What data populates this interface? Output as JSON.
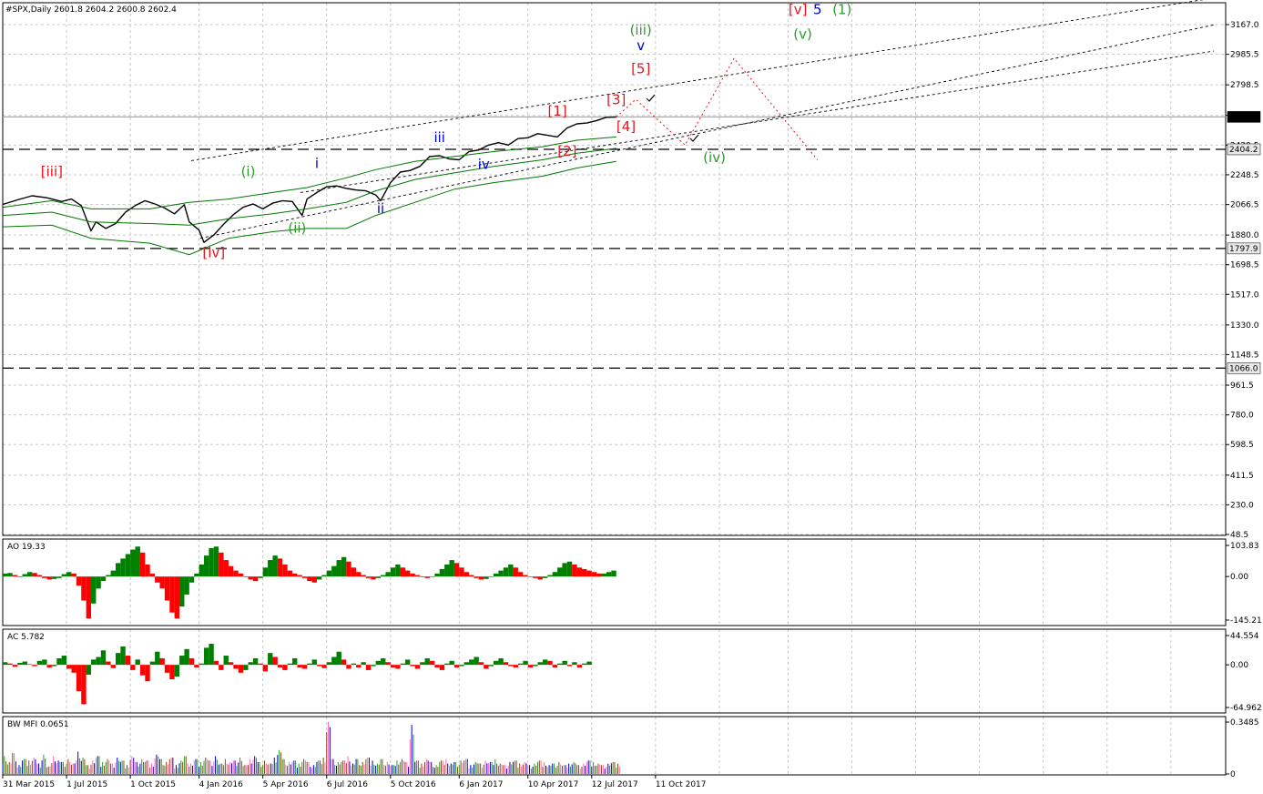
{
  "symbol_header": "#SPX,Daily  2601.8 2604.2 2600.8 2602.4",
  "colors": {
    "price": "#000000",
    "bands": "#007700",
    "grid": "#c8c8c8",
    "up": "#008000",
    "down": "#ff0000",
    "wave_red": "#e8141b",
    "wave_blue": "#0000cc",
    "wave_green": "#2e9a2e",
    "projection": "#e8141b"
  },
  "chart_data": [
    {
      "type": "line",
      "pane": "price",
      "ylim": [
        48.5,
        3330
      ],
      "y_ticks": [
        "3167.0",
        "2985.5",
        "2798.5",
        "2611.5",
        "2429.5",
        "2248.5",
        "2066.5",
        "1880.0",
        "1698.5",
        "1517.0",
        "1330.0",
        "1148.5",
        "961.5",
        "780.0",
        "598.5",
        "411.5",
        "230.0",
        "48.5"
      ],
      "x_ticks": [
        "31 Mar 2015",
        "1 Jul 2015",
        "1 Oct 2015",
        "4 Jan 2016",
        "5 Apr 2016",
        "6 Jul 2016",
        "5 Oct 2016",
        "6 Jan 2017",
        "10 Apr 2017",
        "12 Jul 2017",
        "11 Oct 2017"
      ],
      "x_unit": "weeks from 31 Mar 2015",
      "series": [
        {
          "name": "#SPX",
          "points": [
            [
              0,
              2067
            ],
            [
              3,
              2095
            ],
            [
              6,
              2120
            ],
            [
              9,
              2108
            ],
            [
              12,
              2085
            ],
            [
              14,
              2100
            ],
            [
              16,
              2060
            ],
            [
              18,
              1905
            ],
            [
              19,
              1960
            ],
            [
              21,
              1920
            ],
            [
              23,
              1950
            ],
            [
              25,
              2020
            ],
            [
              27,
              2060
            ],
            [
              29,
              2090
            ],
            [
              31,
              2070
            ],
            [
              33,
              2045
            ],
            [
              35,
              2010
            ],
            [
              37,
              2065
            ],
            [
              38,
              1960
            ],
            [
              40,
              1910
            ],
            [
              41,
              1835
            ],
            [
              43,
              1880
            ],
            [
              45,
              1945
            ],
            [
              47,
              2005
            ],
            [
              49,
              2050
            ],
            [
              51,
              2070
            ],
            [
              53,
              2040
            ],
            [
              55,
              2075
            ],
            [
              57,
              2090
            ],
            [
              59,
              2085
            ],
            [
              61,
              2000
            ],
            [
              62,
              2100
            ],
            [
              64,
              2140
            ],
            [
              66,
              2175
            ],
            [
              68,
              2180
            ],
            [
              70,
              2165
            ],
            [
              72,
              2155
            ],
            [
              74,
              2150
            ],
            [
              76,
              2125
            ],
            [
              77,
              2090
            ],
            [
              79,
              2200
            ],
            [
              81,
              2265
            ],
            [
              83,
              2275
            ],
            [
              85,
              2300
            ],
            [
              87,
              2360
            ],
            [
              89,
              2365
            ],
            [
              91,
              2345
            ],
            [
              93,
              2340
            ],
            [
              95,
              2390
            ],
            [
              97,
              2400
            ],
            [
              99,
              2430
            ],
            [
              101,
              2445
            ],
            [
              103,
              2430
            ],
            [
              105,
              2470
            ],
            [
              107,
              2475
            ],
            [
              109,
              2500
            ],
            [
              111,
              2490
            ],
            [
              113,
              2480
            ],
            [
              115,
              2535
            ],
            [
              117,
              2560
            ],
            [
              119,
              2565
            ],
            [
              121,
              2580
            ],
            [
              123,
              2600
            ],
            [
              125,
              2602
            ]
          ]
        },
        {
          "name": "Upper band",
          "points": [
            [
              0,
              2050
            ],
            [
              10,
              2090
            ],
            [
              18,
              2040
            ],
            [
              30,
              2040
            ],
            [
              38,
              2080
            ],
            [
              46,
              2100
            ],
            [
              55,
              2140
            ],
            [
              62,
              2170
            ],
            [
              70,
              2230
            ],
            [
              76,
              2280
            ],
            [
              84,
              2330
            ],
            [
              92,
              2360
            ],
            [
              100,
              2390
            ],
            [
              110,
              2420
            ],
            [
              117,
              2460
            ],
            [
              125,
              2480
            ]
          ]
        },
        {
          "name": "Lower band",
          "points": [
            [
              0,
              1930
            ],
            [
              10,
              1940
            ],
            [
              18,
              1860
            ],
            [
              30,
              1830
            ],
            [
              38,
              1760
            ],
            [
              46,
              1860
            ],
            [
              55,
              1900
            ],
            [
              62,
              1920
            ],
            [
              70,
              1920
            ],
            [
              76,
              2000
            ],
            [
              84,
              2080
            ],
            [
              92,
              2160
            ],
            [
              100,
              2200
            ],
            [
              110,
              2240
            ],
            [
              117,
              2290
            ],
            [
              125,
              2330
            ]
          ]
        },
        {
          "name": "Middle band",
          "points": [
            [
              0,
              2000
            ],
            [
              10,
              2020
            ],
            [
              18,
              1960
            ],
            [
              30,
              1950
            ],
            [
              38,
              1940
            ],
            [
              46,
              1980
            ],
            [
              55,
              2010
            ],
            [
              62,
              2040
            ],
            [
              70,
              2080
            ],
            [
              76,
              2150
            ],
            [
              84,
              2220
            ],
            [
              92,
              2260
            ],
            [
              100,
              2300
            ],
            [
              110,
              2340
            ],
            [
              117,
              2380
            ],
            [
              125,
              2410
            ]
          ]
        }
      ],
      "horizontal_levels": [
        "2602.4",
        "2404.2",
        "1797.9",
        "1066.0"
      ],
      "projection_path": [
        [
          125,
          2602
        ],
        [
          129,
          2710
        ],
        [
          139,
          2430
        ],
        [
          149,
          2960
        ],
        [
          166,
          2340
        ]
      ],
      "wave_labels": [
        {
          "text": "[iii]",
          "x": 10,
          "y": 2240,
          "color": "red"
        },
        {
          "text": "[iv]",
          "x": 43,
          "y": 1745,
          "color": "red"
        },
        {
          "text": "(i)",
          "x": 50,
          "y": 2240,
          "color": "green"
        },
        {
          "text": "(ii)",
          "x": 60,
          "y": 1895,
          "color": "green"
        },
        {
          "text": "i",
          "x": 64,
          "y": 2290,
          "color": "blue"
        },
        {
          "text": "ii",
          "x": 77,
          "y": 2015,
          "color": "blue"
        },
        {
          "text": "iii",
          "x": 89,
          "y": 2450,
          "color": "blue"
        },
        {
          "text": "iv",
          "x": 98,
          "y": 2285,
          "color": "blue"
        },
        {
          "text": "[1]",
          "x": 113,
          "y": 2610,
          "color": "red"
        },
        {
          "text": "[2]",
          "x": 115,
          "y": 2365,
          "color": "red"
        },
        {
          "text": "[3]",
          "x": 125,
          "y": 2680,
          "color": "red"
        },
        {
          "text": "[4]",
          "x": 127,
          "y": 2515,
          "color": "red"
        },
        {
          "text": "[5]",
          "x": 130,
          "y": 2870,
          "color": "red"
        },
        {
          "text": "v",
          "x": 130,
          "y": 3010,
          "color": "blue"
        },
        {
          "text": "(iii)",
          "x": 130,
          "y": 3105,
          "color": "green"
        },
        {
          "text": "(iv)",
          "x": 145,
          "y": 2325,
          "color": "green"
        },
        {
          "text": "(v)",
          "x": 163,
          "y": 3080,
          "color": "green"
        },
        {
          "text": "[v]",
          "x": 162,
          "y": 3230,
          "color": "red"
        },
        {
          "text": "5",
          "x": 166,
          "y": 3230,
          "color": "blue"
        },
        {
          "text": "(1)",
          "x": 171,
          "y": 3230,
          "color": "green"
        }
      ]
    },
    {
      "type": "bar",
      "pane": "AO",
      "title": "AO 19.33",
      "ylim": [
        -145.21,
        103.83
      ],
      "y_ticks": [
        "103.83",
        "0.00",
        "-145.21"
      ],
      "values": [
        10,
        12,
        5,
        -2,
        8,
        15,
        12,
        5,
        -5,
        -10,
        -8,
        -5,
        8,
        15,
        10,
        -30,
        -80,
        -140,
        -90,
        -40,
        -15,
        5,
        20,
        45,
        60,
        75,
        90,
        100,
        80,
        40,
        10,
        -20,
        -40,
        -80,
        -120,
        -140,
        -100,
        -60,
        -20,
        10,
        40,
        70,
        95,
        100,
        80,
        55,
        35,
        20,
        10,
        0,
        -10,
        -15,
        -5,
        30,
        55,
        70,
        60,
        40,
        20,
        10,
        5,
        -5,
        -15,
        -20,
        -10,
        5,
        20,
        35,
        55,
        65,
        50,
        30,
        15,
        5,
        -5,
        -10,
        -5,
        5,
        15,
        30,
        40,
        30,
        20,
        10,
        5,
        -2,
        -5,
        0,
        10,
        25,
        40,
        55,
        45,
        30,
        15,
        5,
        -5,
        -10,
        -8,
        0,
        10,
        20,
        30,
        40,
        30,
        15,
        5,
        0,
        -5,
        -10,
        -5,
        5,
        15,
        30,
        45,
        50,
        40,
        30,
        25,
        20,
        15,
        10,
        10,
        15,
        20
      ]
    },
    {
      "type": "bar",
      "pane": "AC",
      "title": "AC 5.782",
      "ylim": [
        -64.962,
        44.554
      ],
      "y_ticks": [
        "44.554",
        "0.00",
        "-64.962"
      ],
      "values": [
        4,
        2,
        -3,
        3,
        5,
        1,
        -2,
        6,
        8,
        -4,
        -2,
        10,
        14,
        -6,
        -12,
        -40,
        -60,
        -15,
        8,
        12,
        22,
        5,
        -5,
        18,
        28,
        14,
        -8,
        8,
        -16,
        -25,
        5,
        20,
        10,
        -12,
        -22,
        -18,
        14,
        24,
        10,
        -4,
        2,
        26,
        32,
        6,
        -8,
        14,
        4,
        -6,
        -12,
        -8,
        4,
        10,
        2,
        -10,
        18,
        12,
        -4,
        -8,
        2,
        10,
        -4,
        -6,
        2,
        8,
        -2,
        -5,
        4,
        12,
        20,
        8,
        -6,
        2,
        -4,
        4,
        -8,
        -2,
        6,
        10,
        4,
        -4,
        -6,
        2,
        8,
        -2,
        -6,
        4,
        10,
        6,
        -4,
        -8,
        2,
        6,
        -4,
        -2,
        4,
        8,
        12,
        4,
        -6,
        -2,
        6,
        10,
        4,
        -2,
        -4,
        2,
        6,
        -4,
        -2,
        4,
        8,
        6,
        -4,
        2,
        6,
        -2,
        4,
        -4,
        2,
        5
      ]
    },
    {
      "type": "bar",
      "pane": "BW MFI",
      "title": "BW MFI 0.0651",
      "ylim": [
        0,
        0.3485
      ],
      "y_ticks": [
        "0.3485",
        "0"
      ],
      "values": [
        0.12,
        0.08,
        0.14,
        0.06,
        0.1,
        0.09,
        0.11,
        0.07,
        0.13,
        0.05,
        0.12,
        0.09,
        0.08,
        0.1,
        0.07,
        0.15,
        0.11,
        0.06,
        0.09,
        0.12,
        0.08,
        0.1,
        0.07,
        0.11,
        0.09,
        0.06,
        0.12,
        0.08,
        0.1,
        0.09,
        0.07,
        0.13,
        0.1,
        0.08,
        0.11,
        0.06,
        0.09,
        0.12,
        0.07,
        0.1,
        0.08,
        0.11,
        0.09,
        0.12,
        0.07,
        0.1,
        0.08,
        0.09,
        0.11,
        0.06,
        0.1,
        0.12,
        0.08,
        0.09,
        0.07,
        0.11,
        0.16,
        0.1,
        0.08,
        0.09,
        0.07,
        0.1,
        0.08,
        0.06,
        0.09,
        0.11,
        0.35,
        0.1,
        0.08,
        0.09,
        0.12,
        0.07,
        0.1,
        0.08,
        0.11,
        0.09,
        0.07,
        0.1,
        0.08,
        0.06,
        0.09,
        0.1,
        0.08,
        0.33,
        0.09,
        0.07,
        0.1,
        0.08,
        0.06,
        0.09,
        0.1,
        0.07,
        0.08,
        0.09,
        0.1,
        0.06,
        0.08,
        0.07,
        0.09,
        0.08,
        0.1,
        0.07,
        0.06,
        0.08,
        0.09,
        0.07,
        0.08,
        0.06,
        0.07,
        0.09,
        0.08,
        0.06,
        0.07,
        0.08,
        0.06,
        0.07,
        0.08,
        0.06,
        0.07,
        0.09,
        0.08,
        0.07,
        0.06,
        0.07,
        0.08,
        0.07
      ]
    }
  ]
}
